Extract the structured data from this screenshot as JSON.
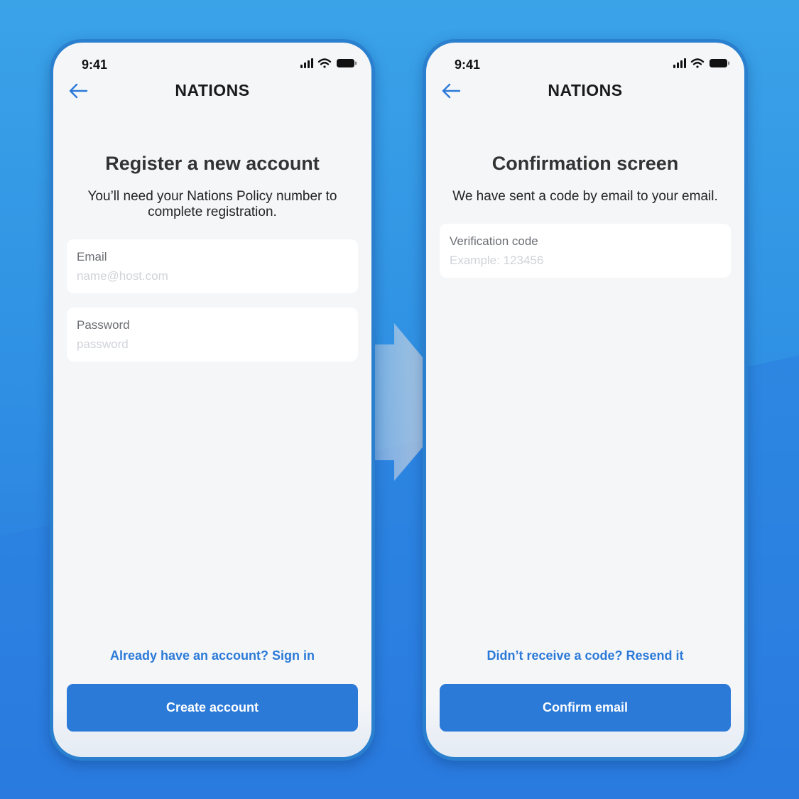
{
  "colors": {
    "accent": "#2b7ad8",
    "background_top": "#3aa3e8",
    "background_bottom": "#2874dd",
    "screen": "#f5f6f8"
  },
  "screens": [
    {
      "status_time": "9:41",
      "brand": "NATIONS",
      "back_icon": "arrow-left-icon",
      "title": "Register a new account",
      "subtitle": "You’ll need your Nations Policy number to complete registration.",
      "fields": [
        {
          "label": "Email",
          "placeholder": "name@host.com",
          "value": ""
        },
        {
          "label": "Password",
          "placeholder": "password",
          "value": ""
        }
      ],
      "link": "Already have an account? Sign in",
      "button": "Create account"
    },
    {
      "status_time": "9:41",
      "brand": "NATIONS",
      "back_icon": "arrow-left-icon",
      "title": "Confirmation screen",
      "subtitle": "We have sent a code by email to your email.",
      "fields": [
        {
          "label": "Verification code",
          "placeholder": "Example: 123456",
          "value": ""
        }
      ],
      "link": "Didn’t receive a code? Resend it",
      "button": "Confirm email"
    }
  ],
  "status_icons": [
    "cellular-signal-icon",
    "wifi-icon",
    "battery-icon"
  ],
  "flow_arrow_icon": "flow-arrow-right-icon"
}
